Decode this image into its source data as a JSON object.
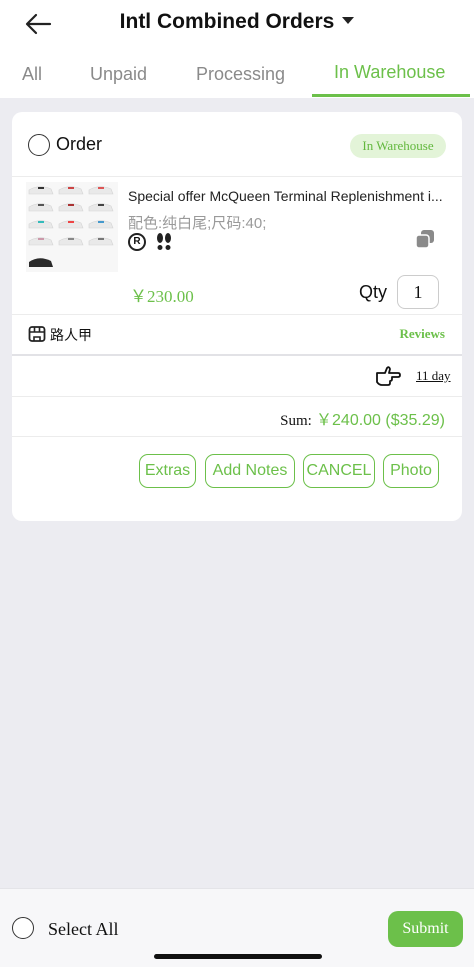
{
  "header": {
    "title": "Intl Combined Orders"
  },
  "tabs": [
    {
      "label": "All",
      "active": false
    },
    {
      "label": "Unpaid",
      "active": false
    },
    {
      "label": "Processing",
      "active": false
    },
    {
      "label": "In Warehouse",
      "active": true
    }
  ],
  "order": {
    "title": "Order",
    "status": "In Warehouse",
    "product": {
      "title": "Special offer McQueen Terminal Replenishment i...",
      "spec": "配色:纯白尾;尺码:40;",
      "price": "￥230.00",
      "qty_label": "Qty",
      "qty": "1"
    },
    "shop_name": "路人甲",
    "reviews_label": "Reviews",
    "days": "11 day",
    "sum_label": "Sum:",
    "sum_value": "￥240.00 ($35.29)",
    "actions": [
      "Extras",
      "Add Notes",
      "CANCEL",
      "Photo"
    ]
  },
  "footer": {
    "select_all_label": "Select All",
    "submit_label": "Submit"
  },
  "colors": {
    "accent": "#6cc04a",
    "badge_bg": "#e3f4d8",
    "page_bg": "#ececf1"
  },
  "icons": [
    "back-arrow-icon",
    "dropdown-caret-icon",
    "registered-icon",
    "footprints-icon",
    "copy-icon",
    "shop-icon",
    "pointing-hand-icon"
  ]
}
